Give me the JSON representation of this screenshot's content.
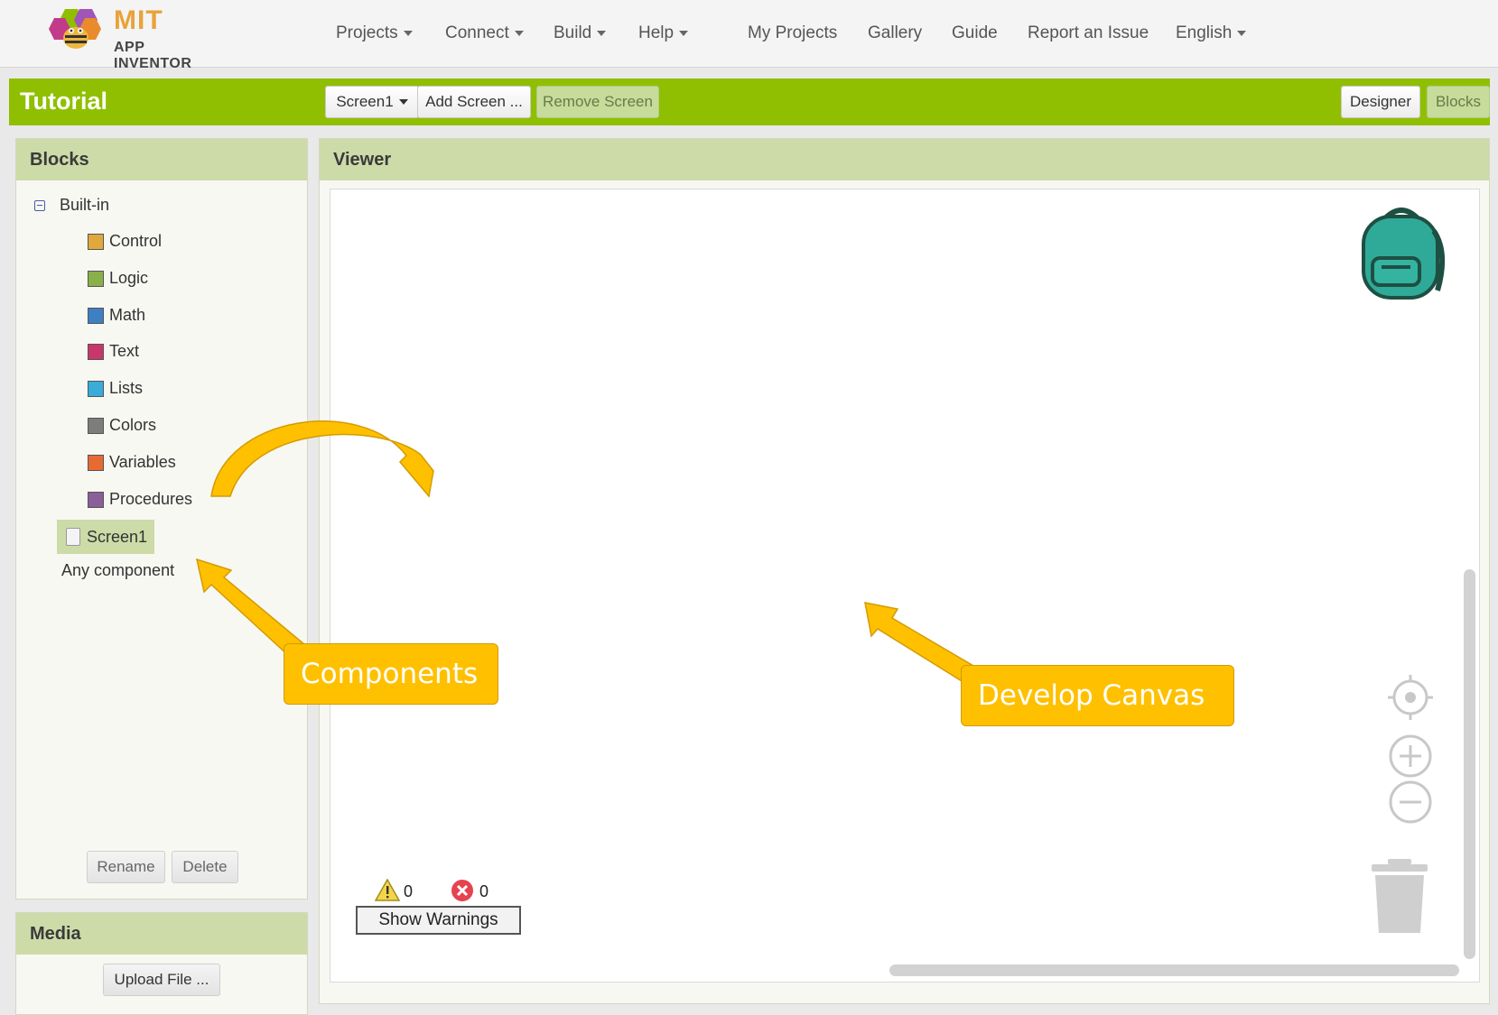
{
  "logo": {
    "line1": "MIT",
    "line2": "APP INVENTOR"
  },
  "nav": {
    "dropdowns": [
      "Projects",
      "Connect",
      "Build",
      "Help"
    ],
    "links": [
      "My Projects",
      "Gallery",
      "Guide",
      "Report an Issue"
    ],
    "language": "English"
  },
  "toolbar": {
    "project_title": "Tutorial",
    "screen_select": "Screen1",
    "add_screen": "Add Screen ...",
    "remove_screen": "Remove Screen",
    "designer": "Designer",
    "blocks": "Blocks"
  },
  "blocks_panel": {
    "title": "Blocks",
    "builtin_label": "Built-in",
    "categories": [
      {
        "label": "Control",
        "color": "#e1a83c"
      },
      {
        "label": "Logic",
        "color": "#8ab04a"
      },
      {
        "label": "Math",
        "color": "#3f7fc4"
      },
      {
        "label": "Text",
        "color": "#c9376a"
      },
      {
        "label": "Lists",
        "color": "#3aacd9"
      },
      {
        "label": "Colors",
        "color": "#7d7d7d"
      },
      {
        "label": "Variables",
        "color": "#e66a32"
      },
      {
        "label": "Procedures",
        "color": "#8b5f98"
      }
    ],
    "screen_item": "Screen1",
    "any_component": "Any component",
    "rename": "Rename",
    "delete": "Delete"
  },
  "media_panel": {
    "title": "Media",
    "upload": "Upload File ..."
  },
  "viewer": {
    "title": "Viewer",
    "warnings_count": "0",
    "errors_count": "0",
    "show_warnings": "Show Warnings"
  },
  "annotations": {
    "components": "Components",
    "develop_canvas": "Develop Canvas"
  },
  "colors": {
    "accent_green": "#8fbf00",
    "panel_header": "#cddba8",
    "callout": "#ffc000"
  }
}
